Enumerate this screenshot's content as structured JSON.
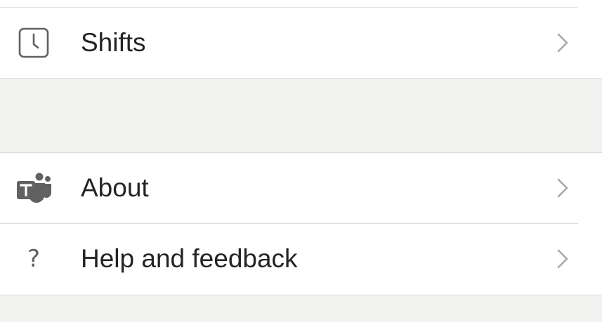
{
  "menu": {
    "items": [
      {
        "label": "Shifts",
        "icon": "clock-icon"
      },
      {
        "label": "About",
        "icon": "teams-logo-icon"
      },
      {
        "label": "Help and feedback",
        "icon": "question-mark-icon"
      }
    ],
    "chevron_icon": "chevron-right-icon"
  },
  "colors": {
    "background": "#f2f2f1",
    "card": "#ffffff",
    "text": "#242424",
    "icon": "#616161",
    "chevron": "#a8a8a8",
    "divider": "#dcdcdc"
  }
}
